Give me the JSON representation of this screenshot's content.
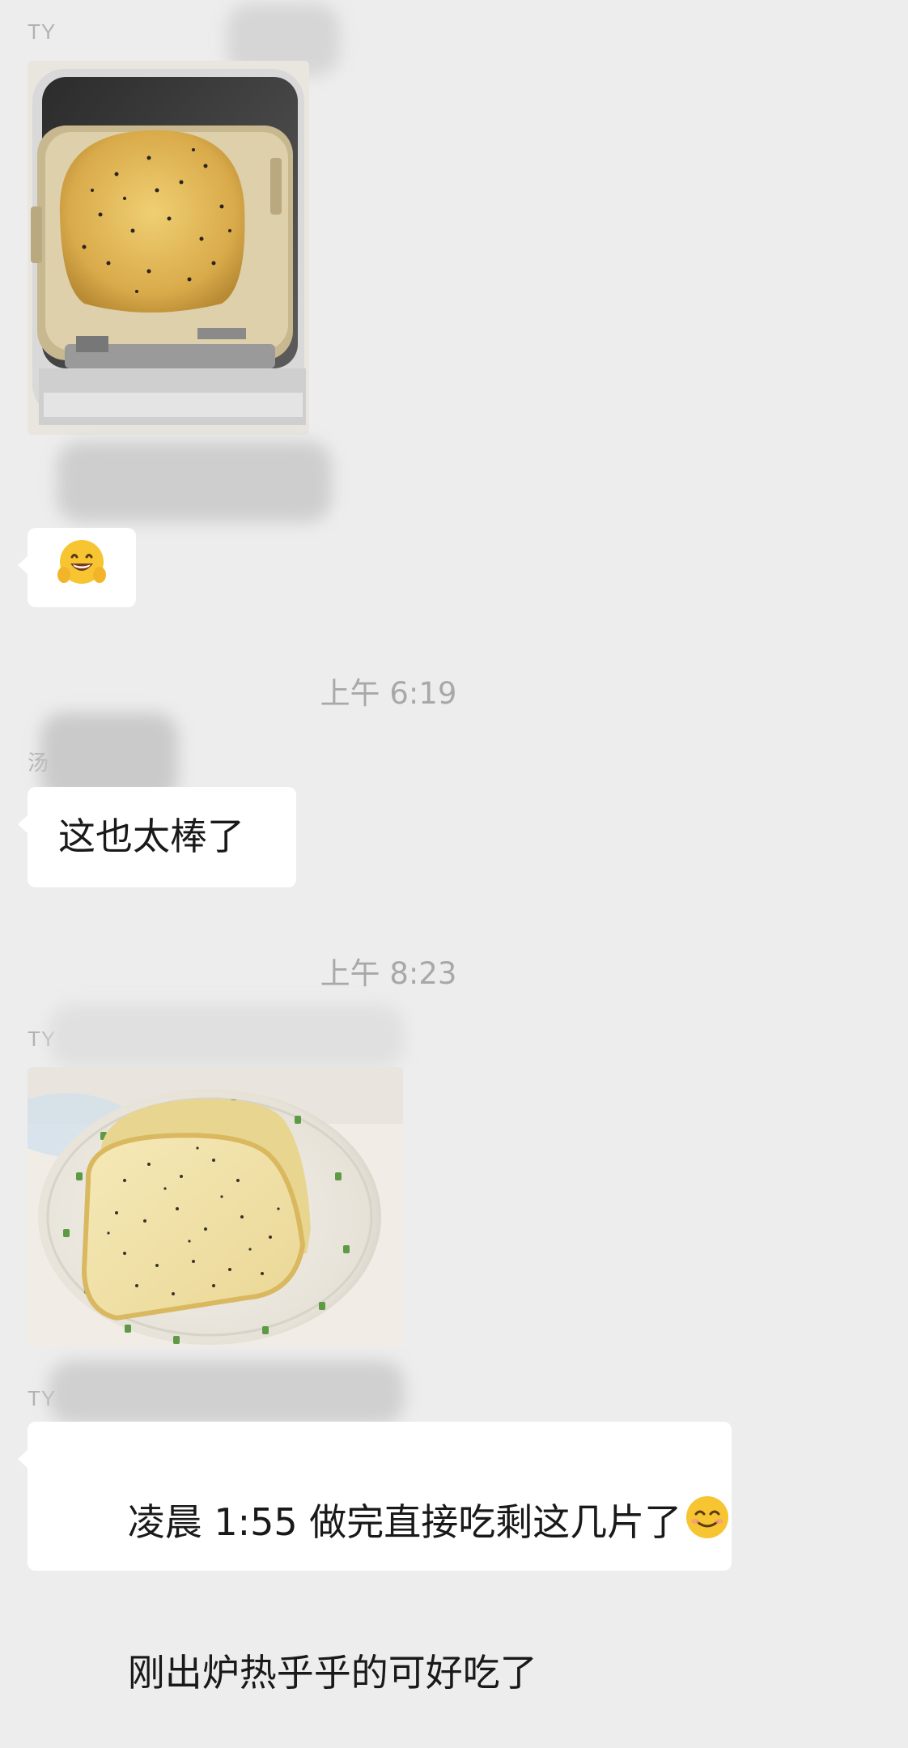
{
  "conversation": {
    "messages": [
      {
        "sender": "TY",
        "type": "image",
        "image_alt": "bread loaf in bread machine pan"
      },
      {
        "sender": "TY",
        "type": "sticker",
        "emoji": "smiling face with open hands"
      },
      {
        "type": "timestamp",
        "text": "上午 6:19"
      },
      {
        "sender": "汤",
        "type": "text",
        "text": "这也太棒了"
      },
      {
        "type": "timestamp",
        "text": "上午 8:23"
      },
      {
        "sender": "TY",
        "type": "image",
        "image_alt": "two slices of sesame bread on a plate"
      },
      {
        "sender": "TY",
        "type": "text",
        "line1": "凌晨 1:55 做完直接吃剩这几片了",
        "line1_emoji": "smiling face with smiling eyes",
        "line2": "刚出炉热乎乎的可好吃了"
      }
    ]
  },
  "colors": {
    "background": "#ededed",
    "bubble": "#ffffff",
    "timestamp_text": "#a8a8a8",
    "message_text": "#191919"
  }
}
